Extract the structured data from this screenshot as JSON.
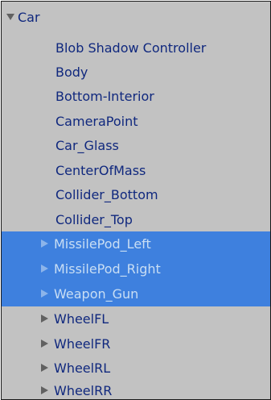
{
  "panel": {
    "colors": {
      "background": "#c2c2c2",
      "border": "#1a1a1a",
      "text": "#10287e",
      "selection_background": "#3e80de",
      "selection_text": "#c9def4",
      "triangle": "#616161",
      "triangle_selected": "#8cb4ea"
    },
    "root": {
      "label": "Car",
      "expanded": true,
      "icon": "expanded-triangle-icon"
    },
    "children": [
      {
        "label": "Blob Shadow Controller",
        "has_children": false,
        "selected": false
      },
      {
        "label": "Body",
        "has_children": false,
        "selected": false
      },
      {
        "label": "Bottom-Interior",
        "has_children": false,
        "selected": false
      },
      {
        "label": "CameraPoint",
        "has_children": false,
        "selected": false
      },
      {
        "label": "Car_Glass",
        "has_children": false,
        "selected": false
      },
      {
        "label": "CenterOfMass",
        "has_children": false,
        "selected": false
      },
      {
        "label": "Collider_Bottom",
        "has_children": false,
        "selected": false
      },
      {
        "label": "Collider_Top",
        "has_children": false,
        "selected": false
      },
      {
        "label": "MissilePod_Left",
        "has_children": true,
        "expanded": false,
        "selected": true
      },
      {
        "label": "MissilePod_Right",
        "has_children": true,
        "expanded": false,
        "selected": true
      },
      {
        "label": "Weapon_Gun",
        "has_children": true,
        "expanded": false,
        "selected": true
      },
      {
        "label": "WheelFL",
        "has_children": true,
        "expanded": false,
        "selected": false
      },
      {
        "label": "WheelFR",
        "has_children": true,
        "expanded": false,
        "selected": false
      },
      {
        "label": "WheelRL",
        "has_children": true,
        "expanded": false,
        "selected": false
      },
      {
        "label": "WheelRR",
        "has_children": true,
        "expanded": false,
        "selected": false
      }
    ]
  }
}
